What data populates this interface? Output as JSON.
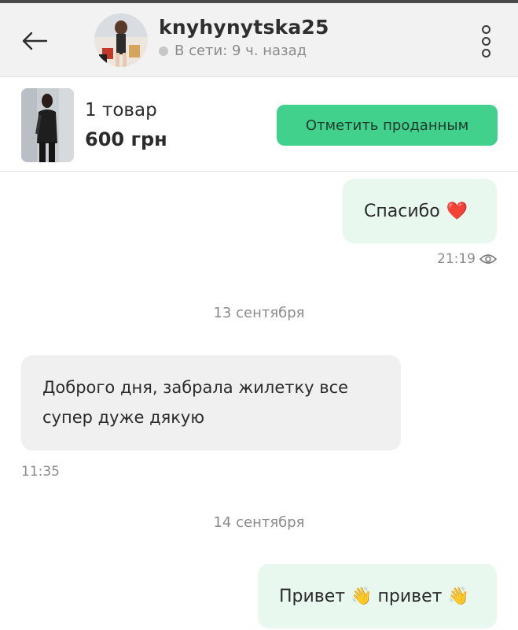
{
  "header": {
    "username": "knyhynytska25",
    "status": "В сети: 9 ч. назад"
  },
  "product": {
    "count": "1 товар",
    "price": "600 грн",
    "mark_sold_label": "Отметить проданным"
  },
  "messages": [
    {
      "direction": "out",
      "text": "Спасибо",
      "emoji": "❤️",
      "time": "21:19",
      "seen": true
    },
    {
      "type": "date",
      "text": "13 сентября"
    },
    {
      "direction": "in",
      "line1": "Доброго дня, забрала жилетку все",
      "line2": "супер дуже дякую",
      "time": "11:35"
    },
    {
      "type": "date",
      "text": "14 сентября"
    },
    {
      "direction": "out",
      "text": "Привет 👋 привет 👋"
    }
  ],
  "colors": {
    "accent_green": "#41d18d",
    "outgoing_bubble": "#e8f8ef",
    "incoming_bubble": "#f0f0f0",
    "header_bg": "#f2f2f2"
  }
}
